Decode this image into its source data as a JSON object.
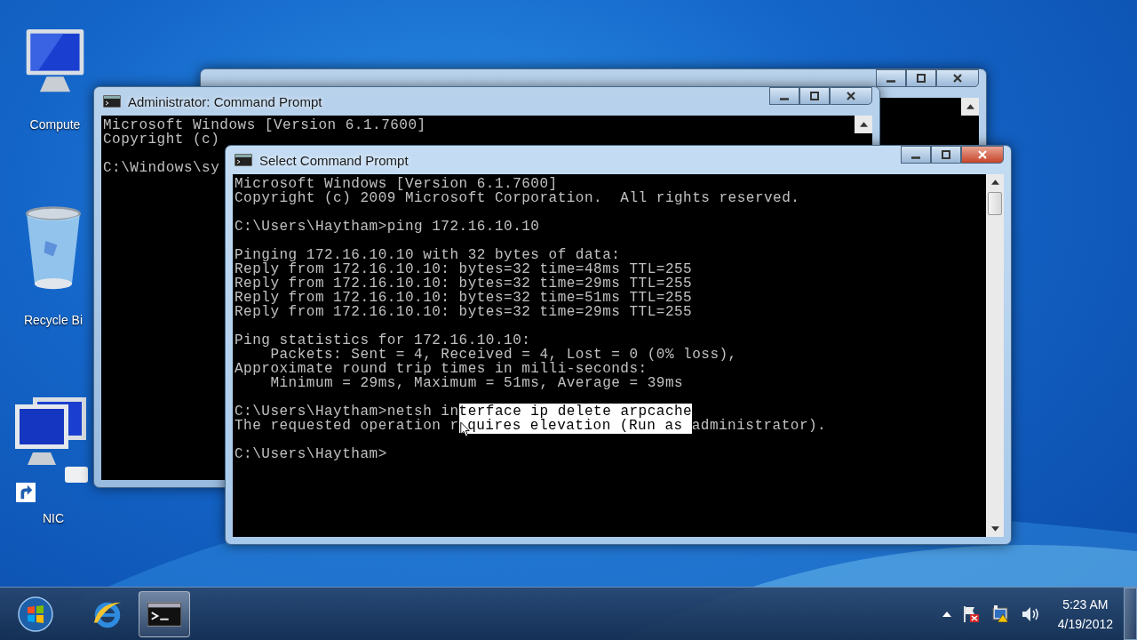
{
  "desktop_icons": [
    {
      "kind": "computer",
      "label": "Compute"
    },
    {
      "kind": "recycle-bin",
      "label": "Recycle Bi"
    },
    {
      "kind": "network",
      "label": "NIC"
    }
  ],
  "windows": [
    {
      "active": false
    },
    {
      "title": "Administrator: Command Prompt",
      "active": false,
      "blocks": [
        {
          "kind": "output",
          "lines": [
            {
              "text": "Microsoft Windows [Version 6.1.7600]"
            },
            {
              "text": "Copyright (c)"
            }
          ]
        },
        {
          "kind": "output",
          "lines": [
            {
              "text": "C:\\Windows\\sy"
            }
          ]
        }
      ]
    },
    {
      "title": "Select Command Prompt",
      "active": true,
      "blocks": [
        {
          "kind": "output",
          "lines": [
            {
              "text": "Microsoft Windows [Version 6.1.7600]"
            },
            {
              "text": "Copyright (c) 2009 Microsoft Corporation.  All rights reserved."
            }
          ]
        },
        {
          "kind": "output",
          "lines": [
            {
              "text": "C:\\Users\\Haytham>ping 172.16.10.10"
            }
          ]
        },
        {
          "kind": "output",
          "lines": [
            {
              "text": "Pinging 172.16.10.10 with 32 bytes of data:"
            },
            {
              "text": "Reply from 172.16.10.10: bytes=32 time=48ms TTL=255"
            },
            {
              "text": "Reply from 172.16.10.10: bytes=32 time=29ms TTL=255"
            },
            {
              "text": "Reply from 172.16.10.10: bytes=32 time=51ms TTL=255"
            },
            {
              "text": "Reply from 172.16.10.10: bytes=32 time=29ms TTL=255"
            }
          ]
        },
        {
          "kind": "output",
          "lines": [
            {
              "text": "Ping statistics for 172.16.10.10:"
            },
            {
              "text": "    Packets: Sent = 4, Received = 4, Lost = 0 (0% loss),"
            },
            {
              "text": "Approximate round trip times in milli-seconds:"
            },
            {
              "text": "    Minimum = 29ms, Maximum = 51ms, Average = 39ms"
            }
          ]
        },
        {
          "kind": "output",
          "lines": [
            {
              "segments": [
                {
                  "text": "C:\\Users\\Haytham>netsh in",
                  "selected": false
                },
                {
                  "text": "terface ip delete arpcache",
                  "selected": true
                }
              ]
            },
            {
              "segments": [
                {
                  "text": "The requested operation r",
                  "selected": false
                },
                {
                  "text": "quires elevation (Run as ",
                  "selected": true,
                  "pointer_before": true
                },
                {
                  "text": "administrator).",
                  "selected": false
                }
              ]
            }
          ]
        },
        {
          "kind": "prompt",
          "lines": [
            {
              "text": "C:\\Users\\Haytham>"
            }
          ]
        }
      ]
    }
  ],
  "taskbar": {
    "items": [
      {
        "kind": "browser",
        "selected": false
      },
      {
        "kind": "console",
        "selected": true
      }
    ],
    "clock": {
      "time": "5:23 AM",
      "date": "4/19/2012"
    }
  }
}
